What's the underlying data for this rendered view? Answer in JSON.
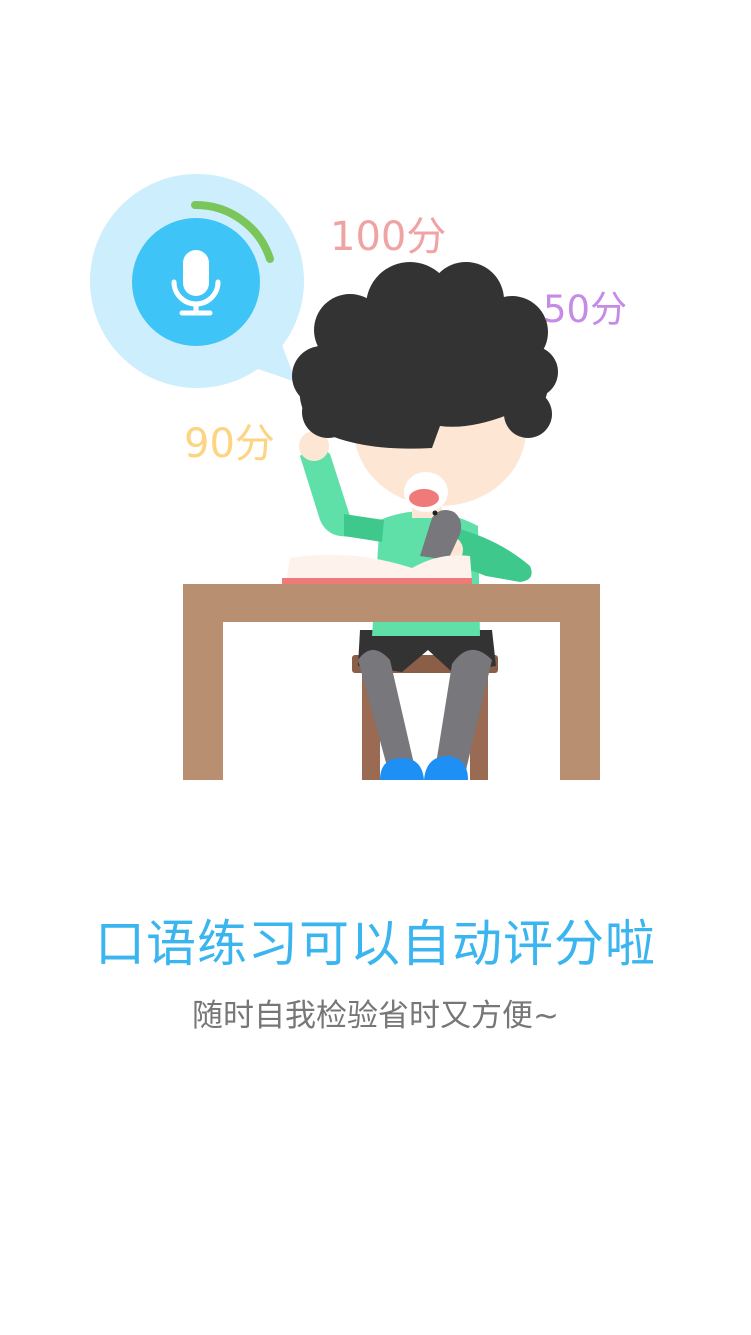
{
  "scores": {
    "score_top": "100分",
    "score_right": "50分",
    "score_left": "90分"
  },
  "text": {
    "headline": "口语练习可以自动评分啦",
    "subline": "随时自我检验省时又方便~"
  },
  "colors": {
    "headline": "#3ab5f0",
    "subline": "#777777",
    "score_top": "#f0a3a3",
    "score_right": "#c58be6",
    "score_left": "#fcd482",
    "bubble": "#cdeefc",
    "mic_circle": "#3ec4f6",
    "progress_arc": "#7ac65a",
    "table": "#b98f72",
    "shirt": "#5fe0a8",
    "hair": "#333333"
  }
}
